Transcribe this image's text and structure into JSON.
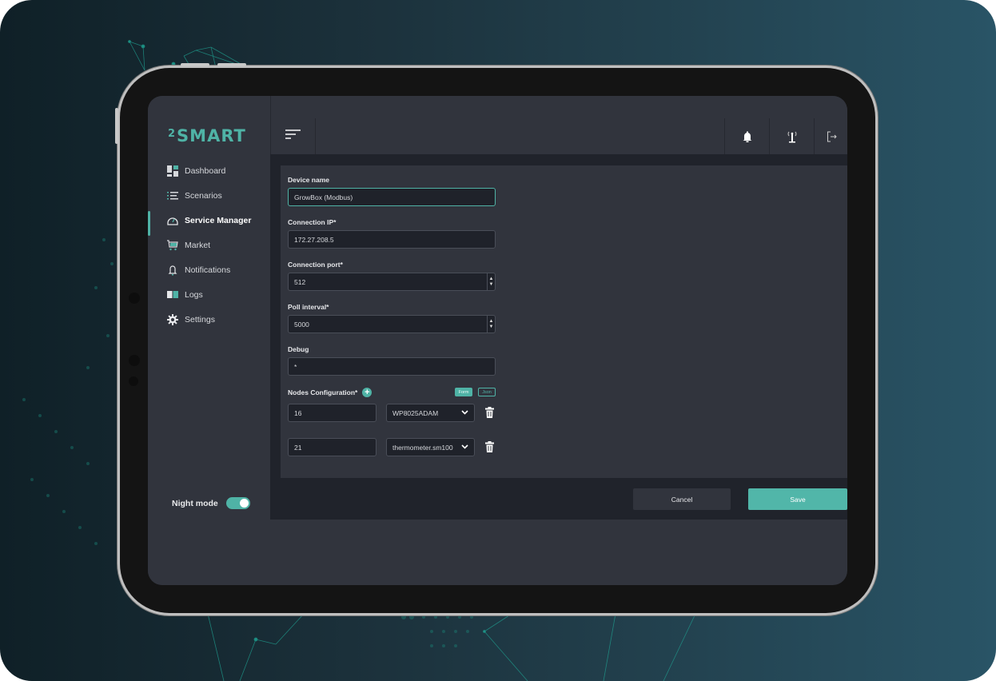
{
  "app": {
    "logo_sup": "2",
    "logo_text": "SMART"
  },
  "sidebar": {
    "items": [
      {
        "label": "Dashboard",
        "icon": "dashboard-icon",
        "active": false
      },
      {
        "label": "Scenarios",
        "icon": "list-icon",
        "active": false
      },
      {
        "label": "Service Manager",
        "icon": "gauge-icon",
        "active": true
      },
      {
        "label": "Market",
        "icon": "cart-icon",
        "active": false
      },
      {
        "label": "Notifications",
        "icon": "bell-icon",
        "active": false
      },
      {
        "label": "Logs",
        "icon": "book-icon",
        "active": false
      },
      {
        "label": "Settings",
        "icon": "gear-icon",
        "active": false
      }
    ],
    "night_mode_label": "Night mode",
    "night_mode_on": true
  },
  "header": {
    "menu_icon": "menu-icon",
    "icons": [
      "bell-icon",
      "antenna-icon",
      "logout-icon"
    ]
  },
  "form": {
    "device_name": {
      "label": "Device name",
      "value": "GrowBox (Modbus)"
    },
    "connection_ip": {
      "label": "Connection IP*",
      "value": "172.27.208.5"
    },
    "connection_port": {
      "label": "Connection port*",
      "value": "512"
    },
    "poll_interval": {
      "label": "Poll interval*",
      "value": "5000"
    },
    "debug": {
      "label": "Debug",
      "value": "*"
    },
    "nodes": {
      "label": "Nodes Configuration*",
      "mode_form": "Form",
      "mode_json": "Json",
      "active_mode": "Form",
      "rows": [
        {
          "id": "16",
          "type": "WP8025ADAM"
        },
        {
          "id": "21",
          "type": "thermometer.sm100"
        }
      ]
    }
  },
  "footer": {
    "cancel_label": "Cancel",
    "save_label": "Save"
  },
  "colors": {
    "accent": "#4fb3a6",
    "panel": "#31343d",
    "content_bg": "#20232b"
  }
}
